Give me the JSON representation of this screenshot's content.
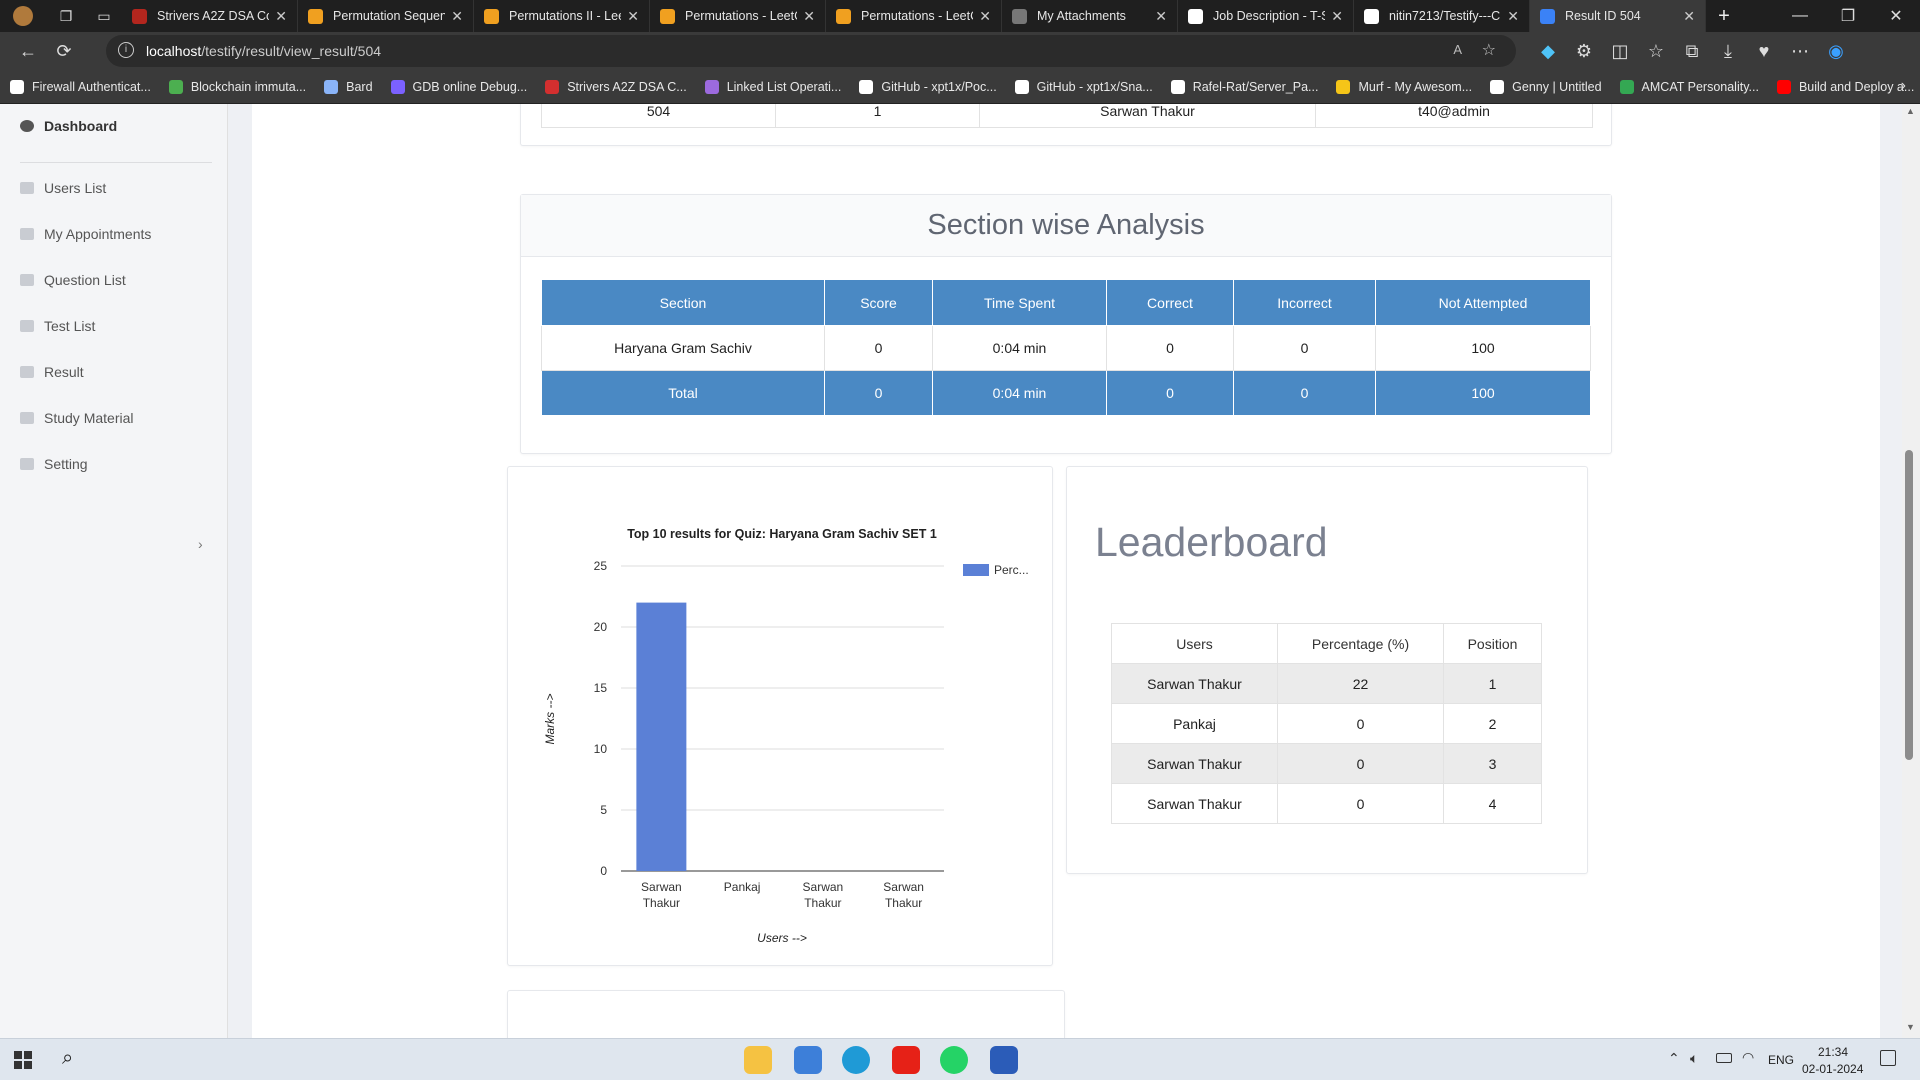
{
  "browser": {
    "tabs": [
      {
        "label": "Strivers A2Z DSA Co",
        "color": "#b3261e"
      },
      {
        "label": "Permutation Sequen",
        "color": "#f0a020"
      },
      {
        "label": "Permutations II - Lee",
        "color": "#f0a020"
      },
      {
        "label": "Permutations - LeetC",
        "color": "#f0a020"
      },
      {
        "label": "Permutations - LeetC",
        "color": "#f0a020"
      },
      {
        "label": "My Attachments",
        "color": "#777777"
      },
      {
        "label": "Job Description - T-S",
        "color": "#ffffff"
      },
      {
        "label": "nitin7213/Testify---C",
        "color": "#ffffff"
      },
      {
        "label": "Result ID 504",
        "color": "#3b82f6"
      }
    ],
    "url_host": "localhost",
    "url_path": "/testify/result/view_result/504",
    "bookmarks": [
      "Firewall Authenticat...",
      "Blockchain immuta...",
      "Bard",
      "GDB online Debug...",
      "Strivers A2Z DSA C...",
      "Linked List Operati...",
      "GitHub - xpt1x/Poc...",
      "GitHub - xpt1x/Sna...",
      "Rafel-Rat/Server_Pa...",
      "Murf - My Awesom...",
      "Genny | Untitled",
      "AMCAT Personality...",
      "Build and Deploy a..."
    ]
  },
  "sidebar": {
    "items": [
      "Dashboard",
      "Users List",
      "My Appointments",
      "Question List",
      "Test List",
      "Result",
      "Study Material",
      "Setting"
    ]
  },
  "top_table": {
    "row": [
      "504",
      "1",
      "Sarwan Thakur",
      "t40@admin"
    ]
  },
  "section_analysis": {
    "title": "Section wise Analysis",
    "headers": [
      "Section",
      "Score",
      "Time Spent",
      "Correct",
      "Incorrect",
      "Not Attempted"
    ],
    "row": [
      "Haryana Gram Sachiv",
      "0",
      "0:04 min",
      "0",
      "0",
      "100"
    ],
    "total": [
      "Total",
      "0",
      "0:04 min",
      "0",
      "0",
      "100"
    ]
  },
  "chart_data": {
    "type": "bar",
    "title": "Top 10 results for Quiz: Haryana Gram Sachiv SET 1",
    "categories": [
      "Sarwan Thakur",
      "Pankaj",
      "Sarwan Thakur",
      "Sarwan Thakur"
    ],
    "series": [
      {
        "name": "Perc...",
        "values": [
          22,
          0,
          0,
          0
        ]
      }
    ],
    "xlabel": "Users -->",
    "ylabel": "Marks -->",
    "ylim": [
      0,
      25
    ],
    "yticks": [
      0,
      5,
      10,
      15,
      20,
      25
    ],
    "grid": true,
    "legend": "top-right",
    "bar_color": "#5b80d6"
  },
  "leaderboard": {
    "title": "Leaderboard",
    "headers": [
      "Users",
      "Percentage (%)",
      "Position"
    ],
    "rows": [
      [
        "Sarwan Thakur",
        "22",
        "1"
      ],
      [
        "Pankaj",
        "0",
        "2"
      ],
      [
        "Sarwan Thakur",
        "0",
        "3"
      ],
      [
        "Sarwan Thakur",
        "0",
        "4"
      ]
    ]
  },
  "taskbar": {
    "lang": "ENG",
    "time": "21:34",
    "date": "02-01-2024"
  }
}
